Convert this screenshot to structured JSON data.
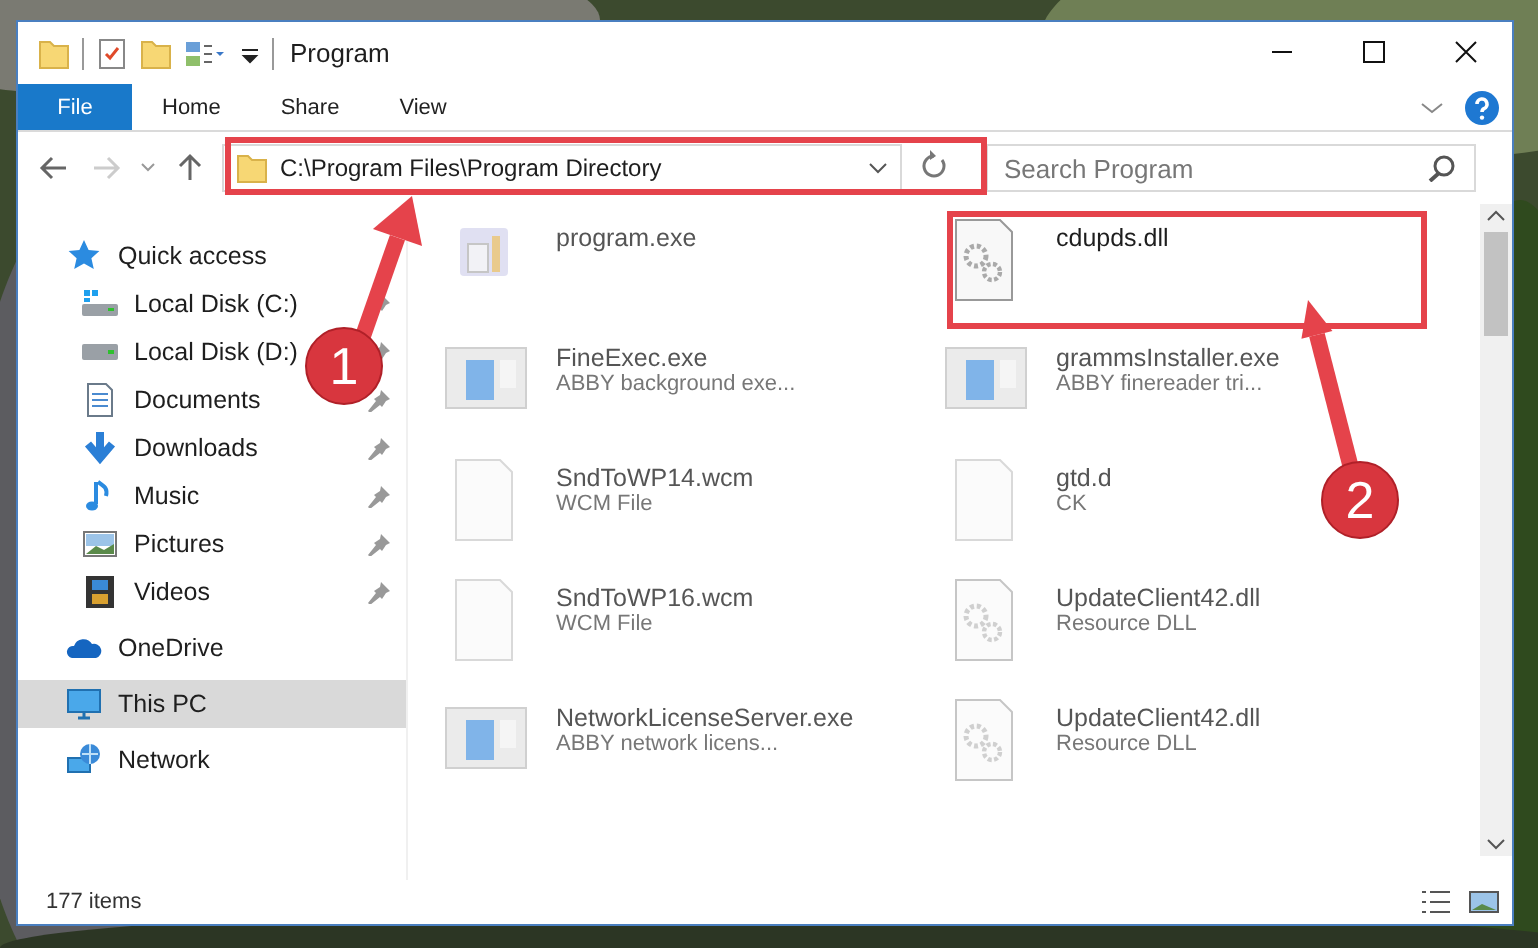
{
  "window": {
    "title": "Program"
  },
  "ribbon": {
    "tabs": [
      {
        "label": "File",
        "kind": "file",
        "selected": false
      },
      {
        "label": "Home",
        "kind": "tab",
        "selected": false
      },
      {
        "label": "Share",
        "kind": "tab",
        "selected": false
      },
      {
        "label": "View",
        "kind": "tab",
        "selected": false
      }
    ]
  },
  "address": {
    "path": "C:\\Program Files\\Program Directory"
  },
  "search": {
    "placeholder": "Search Program"
  },
  "sidebar": {
    "items": [
      {
        "label": "Quick access",
        "kind": "star",
        "selected": false,
        "children": [
          {
            "label": "Local Disk (C:)",
            "kind": "disk-c",
            "pinned": true,
            "selected": false
          },
          {
            "label": "Local Disk (D:)",
            "kind": "disk",
            "pinned": true,
            "selected": false
          },
          {
            "label": "Documents",
            "kind": "documents",
            "pinned": true,
            "selected": false
          },
          {
            "label": "Downloads",
            "kind": "downloads",
            "pinned": true,
            "selected": false
          },
          {
            "label": "Music",
            "kind": "music",
            "pinned": true,
            "selected": false
          },
          {
            "label": "Pictures",
            "kind": "pictures",
            "pinned": true,
            "selected": false
          },
          {
            "label": "Videos",
            "kind": "videos",
            "pinned": true,
            "selected": false
          }
        ]
      },
      {
        "label": "OneDrive",
        "kind": "cloud",
        "selected": false
      },
      {
        "label": "This PC",
        "kind": "pc",
        "selected": true
      },
      {
        "label": "Network",
        "kind": "network",
        "selected": false
      }
    ]
  },
  "files": [
    {
      "name": "program.exe",
      "kind": "installer",
      "blurred": true
    },
    {
      "name": "cdupds.dll",
      "kind": "dll",
      "blurred": false
    },
    {
      "name": "FineExec.exe",
      "description": "ABBY background exe...",
      "kind": "app",
      "blurred": true
    },
    {
      "name": "grammsInstaller.exe",
      "description": "ABBY finereader tri...",
      "kind": "app",
      "blurred": true
    },
    {
      "name": "SndToWP14.wcm",
      "description": "WCM File",
      "kind": "blank",
      "blurred": true
    },
    {
      "name": "gtd.d",
      "description": "CK",
      "kind": "blank",
      "blurred": true
    },
    {
      "name": "SndToWP16.wcm",
      "description": "WCM File",
      "kind": "blank",
      "blurred": true
    },
    {
      "name": "UpdateClient42.dll",
      "description": "Resource DLL",
      "kind": "dll",
      "blurred": true
    },
    {
      "name": "NetworkLicenseServer.exe",
      "description": "ABBY network licens...",
      "kind": "app",
      "blurred": true
    },
    {
      "name": "UpdateClient42.dll",
      "description": "Resource DLL",
      "kind": "dll",
      "blurred": true
    }
  ],
  "status_bar": {
    "count": "177 items"
  },
  "annotations": [
    {
      "label": "1",
      "kind": "address"
    },
    {
      "label": "2",
      "kind": "file"
    }
  ]
}
